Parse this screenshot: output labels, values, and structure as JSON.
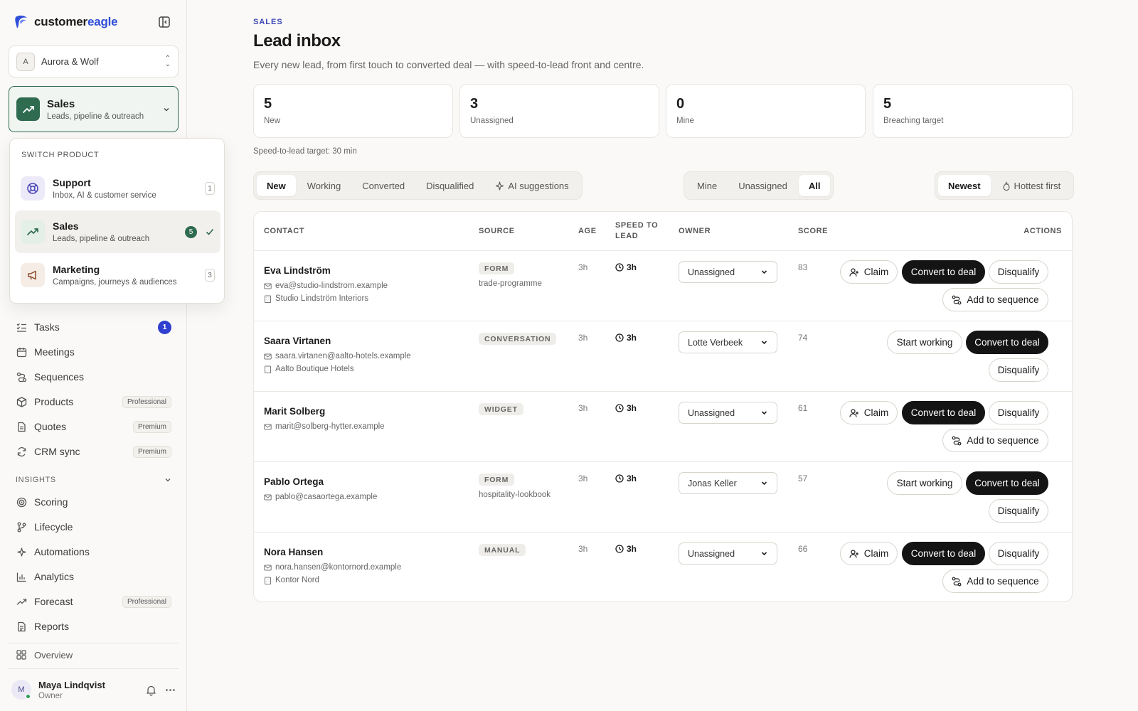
{
  "brand": {
    "name_part1": "customer",
    "name_part2": "eagle"
  },
  "workspace": {
    "initial": "A",
    "name": "Aurora & Wolf"
  },
  "product_switch": {
    "title": "Sales",
    "subtitle": "Leads, pipeline & outreach"
  },
  "popover": {
    "heading": "SWITCH PRODUCT",
    "items": [
      {
        "title": "Support",
        "subtitle": "Inbox, AI & customer service",
        "count": "1",
        "icon": "lifebuoy-icon"
      },
      {
        "title": "Sales",
        "subtitle": "Leads, pipeline & outreach",
        "count": "5",
        "icon": "trend-up-icon",
        "selected": true
      },
      {
        "title": "Marketing",
        "subtitle": "Campaigns, journeys & audiences",
        "count": "3",
        "icon": "megaphone-icon"
      }
    ]
  },
  "nav": {
    "tasks": {
      "label": "Tasks",
      "badge": "1"
    },
    "meetings": {
      "label": "Meetings"
    },
    "sequences": {
      "label": "Sequences"
    },
    "products": {
      "label": "Products",
      "tier": "Professional"
    },
    "quotes": {
      "label": "Quotes",
      "tier": "Premium"
    },
    "crm_sync": {
      "label": "CRM sync",
      "tier": "Premium"
    },
    "insights_label": "INSIGHTS",
    "scoring": {
      "label": "Scoring"
    },
    "lifecycle": {
      "label": "Lifecycle"
    },
    "automations": {
      "label": "Automations"
    },
    "analytics": {
      "label": "Analytics"
    },
    "forecast": {
      "label": "Forecast",
      "tier": "Professional"
    },
    "reports": {
      "label": "Reports"
    },
    "overview": {
      "label": "Overview"
    }
  },
  "user": {
    "initial": "M",
    "name": "Maya Lindqvist",
    "role": "Owner"
  },
  "page": {
    "eyebrow": "SALES",
    "title": "Lead inbox",
    "description": "Every new lead, from first touch to converted deal — with speed-to-lead front and centre.",
    "speed_target": "Speed-to-lead target: 30 min"
  },
  "stats": [
    {
      "value": "5",
      "label": "New"
    },
    {
      "value": "3",
      "label": "Unassigned"
    },
    {
      "value": "0",
      "label": "Mine"
    },
    {
      "value": "5",
      "label": "Breaching target"
    }
  ],
  "status_filters": [
    "New",
    "Working",
    "Converted",
    "Disqualified",
    "AI suggestions"
  ],
  "owner_filters": [
    "Mine",
    "Unassigned",
    "All"
  ],
  "sort_options": [
    "Newest",
    "Hottest first"
  ],
  "table": {
    "headers": {
      "contact": "CONTACT",
      "source": "SOURCE",
      "age": "AGE",
      "speed": "SPEED TO LEAD",
      "owner": "OWNER",
      "score": "SCORE",
      "actions": "ACTIONS"
    },
    "rows": [
      {
        "name": "Eva Lindström",
        "email": "eva@studio-lindstrom.example",
        "company": "Studio Lindström Interiors",
        "source": "FORM",
        "source_detail": "trade-programme",
        "age": "3h",
        "speed": "3h",
        "owner": "Unassigned",
        "score": "83"
      },
      {
        "name": "Saara Virtanen",
        "email": "saara.virtanen@aalto-hotels.example",
        "company": "Aalto Boutique Hotels",
        "source": "CONVERSATION",
        "source_detail": "",
        "age": "3h",
        "speed": "3h",
        "owner": "Lotte Verbeek",
        "score": "74"
      },
      {
        "name": "Marit Solberg",
        "email": "marit@solberg-hytter.example",
        "company": "",
        "source": "WIDGET",
        "source_detail": "",
        "age": "3h",
        "speed": "3h",
        "owner": "Unassigned",
        "score": "61"
      },
      {
        "name": "Pablo Ortega",
        "email": "pablo@casaortega.example",
        "company": "",
        "source": "FORM",
        "source_detail": "hospitality-lookbook",
        "age": "3h",
        "speed": "3h",
        "owner": "Jonas Keller",
        "score": "57"
      },
      {
        "name": "Nora Hansen",
        "email": "nora.hansen@kontornord.example",
        "company": "Kontor Nord",
        "source": "MANUAL",
        "source_detail": "",
        "age": "3h",
        "speed": "3h",
        "owner": "Unassigned",
        "score": "66"
      }
    ],
    "actions": {
      "claim": "Claim",
      "convert": "Convert to deal",
      "disqualify": "Disqualify",
      "add_sequence": "Add to sequence",
      "start_working": "Start working"
    }
  },
  "colors": {
    "accent": "#2f6b4f",
    "brand_blue": "#2f4fd8",
    "badge": "#2f3fcf"
  }
}
